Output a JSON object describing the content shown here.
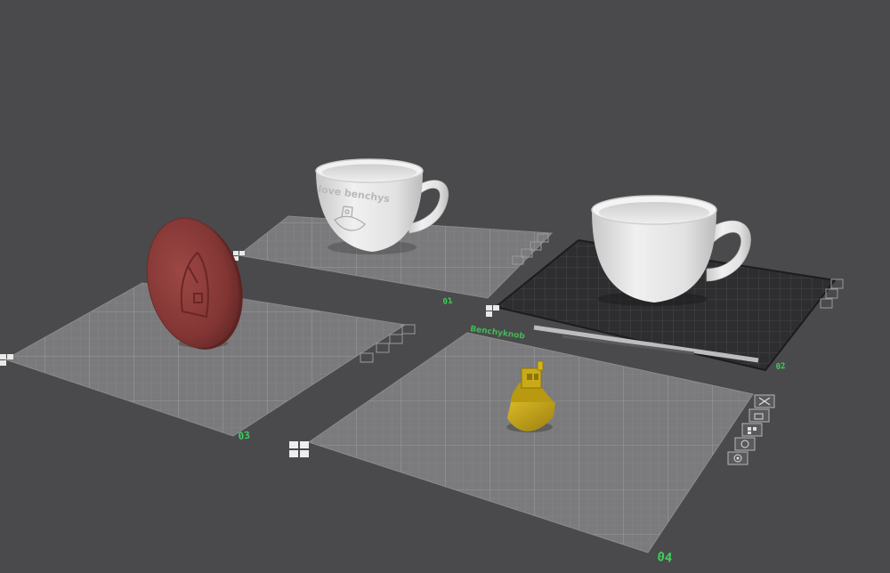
{
  "colors": {
    "background": "#4a4a4c",
    "plate_light": "#7b7b7d",
    "plate_dark": "#2f2f31",
    "plate_label": "#3fcf5a",
    "coin": "#8a3a38",
    "benchy": "#c2a316",
    "cup": "#e4e4e4"
  },
  "plates": [
    {
      "number": "01",
      "style": "light"
    },
    {
      "number": "02",
      "style": "textured-dark",
      "name": "Benchyknob"
    },
    {
      "number": "03",
      "style": "light"
    },
    {
      "number": "04",
      "style": "light",
      "selected": true
    }
  ],
  "objects": {
    "cup_engraved": {
      "text": "love benchys",
      "icon": "benchy-engraving-icon"
    },
    "cup_plain": {},
    "coin": {
      "icon": "benchy-relief-icon"
    },
    "benchy": {}
  },
  "plate_toolbar": {
    "icons": [
      "close-icon",
      "lock-icon",
      "arrange-icon",
      "orient-icon",
      "settings-icon"
    ]
  }
}
